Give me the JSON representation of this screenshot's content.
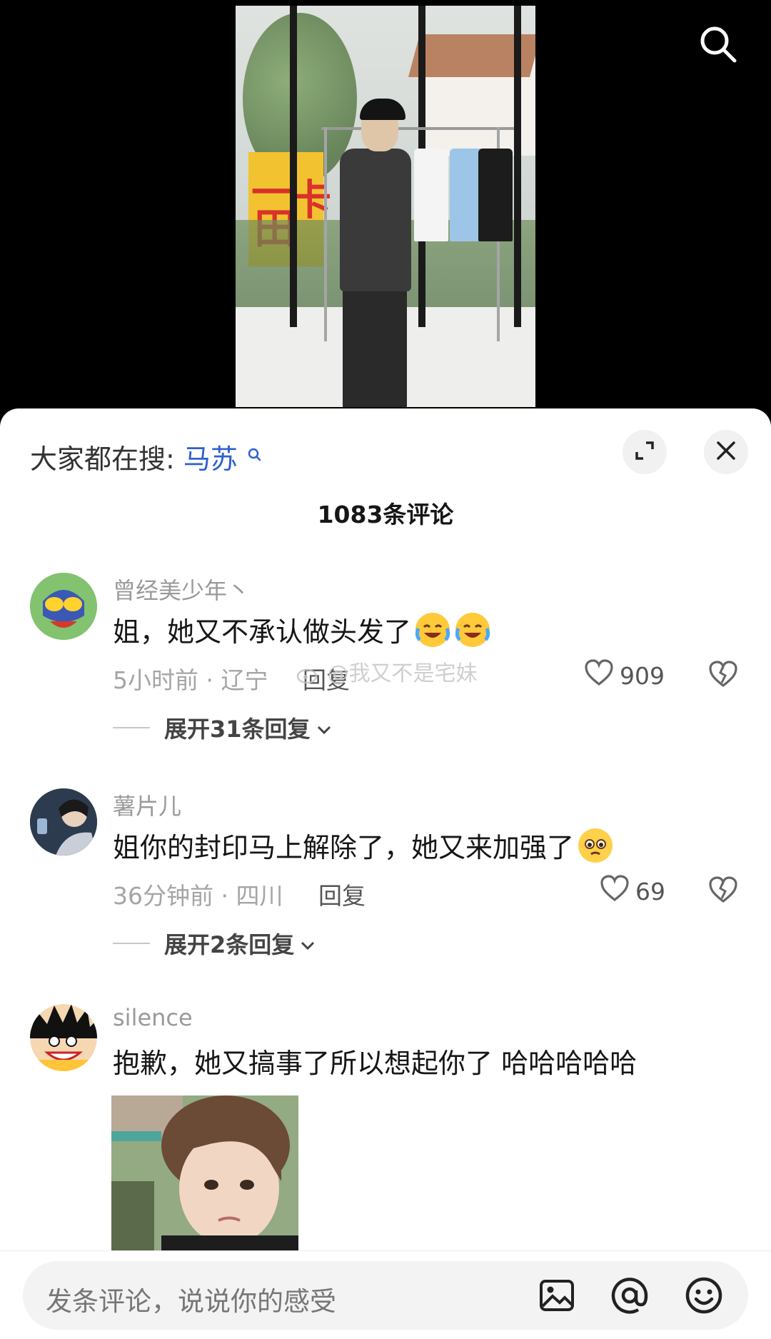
{
  "video": {
    "search_icon": "search-icon"
  },
  "sheet": {
    "search_hint_label": "大家都在搜:",
    "search_hint_term": "马苏",
    "comment_count": "1083条评论",
    "icons": {
      "expand": "expand-icon",
      "close": "close-icon"
    }
  },
  "comments": [
    {
      "username": "曾经美少年丶",
      "text": "姐，她又不承认做头发了",
      "meta": "5小时前 · 辽宁",
      "reply_label": "回复",
      "likes": "909",
      "expand_label": "展开31条回复"
    },
    {
      "username": "薯片儿",
      "text": "姐你的封印马上解除了，她又来加强了",
      "meta": "36分钟前 · 四川",
      "reply_label": "回复",
      "likes": "69",
      "expand_label": "展开2条回复"
    },
    {
      "username": "silence",
      "text": "抱歉，她又搞事了所以想起你了 哈哈哈哈哈"
    }
  ],
  "watermark": "@我又不是宅妹",
  "composer": {
    "placeholder": "发条评论，说说你的感受",
    "icons": {
      "image": "image-icon",
      "mention": "at-icon",
      "emoji": "emoji-icon"
    }
  },
  "colors": {
    "accent_link": "#2f5fd0",
    "sheet_bg": "#ffffff",
    "video_bg": "#000000"
  }
}
